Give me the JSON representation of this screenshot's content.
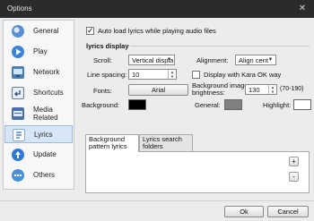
{
  "window": {
    "title": "Options",
    "close_glyph": "✕"
  },
  "sidebar": {
    "items": [
      {
        "label": "General",
        "icon": "general-icon",
        "color": "#5b8fd3"
      },
      {
        "label": "Play",
        "icon": "play-icon",
        "color": "#3b83d6"
      },
      {
        "label": "Network",
        "icon": "network-icon",
        "color": "#4a7fb5"
      },
      {
        "label": "Shortcuts",
        "icon": "shortcuts-icon",
        "color": "#6c7f9a"
      },
      {
        "label": "Media Related",
        "icon": "media-related-icon",
        "color": "#4b6fa8"
      },
      {
        "label": "Lyrics",
        "icon": "lyrics-icon",
        "color": "#2d6fd0",
        "selected": true
      },
      {
        "label": "Update",
        "icon": "update-icon",
        "color": "#2f78d6"
      },
      {
        "label": "Others",
        "icon": "others-icon",
        "color": "#4a90d9"
      }
    ]
  },
  "lyrics": {
    "auto_load_label": "Auto load lyrics while playing audio files",
    "auto_load_checked": true,
    "display_title": "lyrics display",
    "scroll_label": "Scroll:",
    "scroll_value": "Vertical displa",
    "alignment_label": "Alignment:",
    "alignment_value": "Align cent",
    "line_spacing_label": "Line spacing:",
    "line_spacing_value": "10",
    "kara_ok_label": "Display with Kara OK way",
    "kara_ok_checked": false,
    "fonts_label": "Fonts:",
    "font_button_label": "Arial",
    "bg_brightness_label_1": "Background image",
    "bg_brightness_label_2": "brightness:",
    "bg_brightness_value": "130",
    "bg_brightness_range": "(70-190)",
    "background_label": "Background:",
    "background_color": "#000000",
    "general_label": "General:",
    "general_color": "#808080",
    "highlight_label": "Highlight:",
    "highlight_color": "#ffffff",
    "tabs": [
      {
        "label": "Background pattern lyrics",
        "active": true
      },
      {
        "label": "Lyrics search folders",
        "active": false
      }
    ],
    "add_glyph": "+",
    "remove_glyph": "-"
  },
  "footer": {
    "ok_label": "Ok",
    "cancel_label": "Cancel"
  }
}
